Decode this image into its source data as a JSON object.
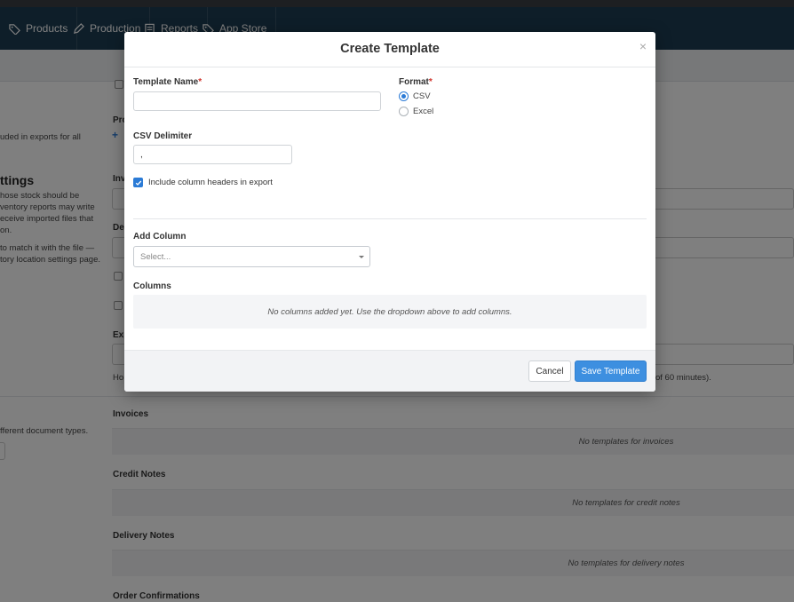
{
  "nav": {
    "items": [
      {
        "label": "Products",
        "icon": "tag-icon"
      },
      {
        "label": "Production",
        "icon": "pencil-icon"
      },
      {
        "label": "Reports",
        "icon": "report-icon"
      },
      {
        "label": "App Store",
        "icon": "tag-icon"
      }
    ]
  },
  "background": {
    "left_text_1": "uded in exports for all",
    "settings_heading": "ttings",
    "settings_lines": [
      "hose stock should be",
      "ventory reports may write",
      "eceive imported files that",
      "on."
    ],
    "settings_lines_2": [
      "to match it with the file —",
      "tory location settings page."
    ],
    "pro_label": "Pro",
    "inv_label": "Inv",
    "del_label": "De",
    "exp_label": "Exp",
    "ho_text": "Ho",
    "minutes_text": "of 60 minutes).",
    "doc_types_text": "fferent document types.",
    "sections": [
      {
        "label": "Invoices",
        "empty": "No templates for invoices"
      },
      {
        "label": "Credit Notes",
        "empty": "No templates for credit notes"
      },
      {
        "label": "Delivery Notes",
        "empty": "No templates for delivery notes"
      },
      {
        "label": "Order Confirmations",
        "empty": ""
      }
    ]
  },
  "modal": {
    "title": "Create Template",
    "close": "×",
    "template_name_label": "Template Name",
    "required_mark": "*",
    "template_name_value": "",
    "format_label": "Format",
    "format_options": [
      "CSV",
      "Excel"
    ],
    "format_selected": "CSV",
    "csv_delimiter_label": "CSV Delimiter",
    "csv_delimiter_value": ",",
    "include_headers_label": "Include column headers in export",
    "include_headers_checked": true,
    "add_column_label": "Add Column",
    "add_column_placeholder": "Select...",
    "columns_label": "Columns",
    "columns_empty": "No columns added yet. Use the dropdown above to add columns.",
    "cancel_label": "Cancel",
    "save_label": "Save Template"
  },
  "colors": {
    "accent": "#3d8fe0",
    "topbar": "#1d3c52",
    "required": "#d0342c"
  }
}
